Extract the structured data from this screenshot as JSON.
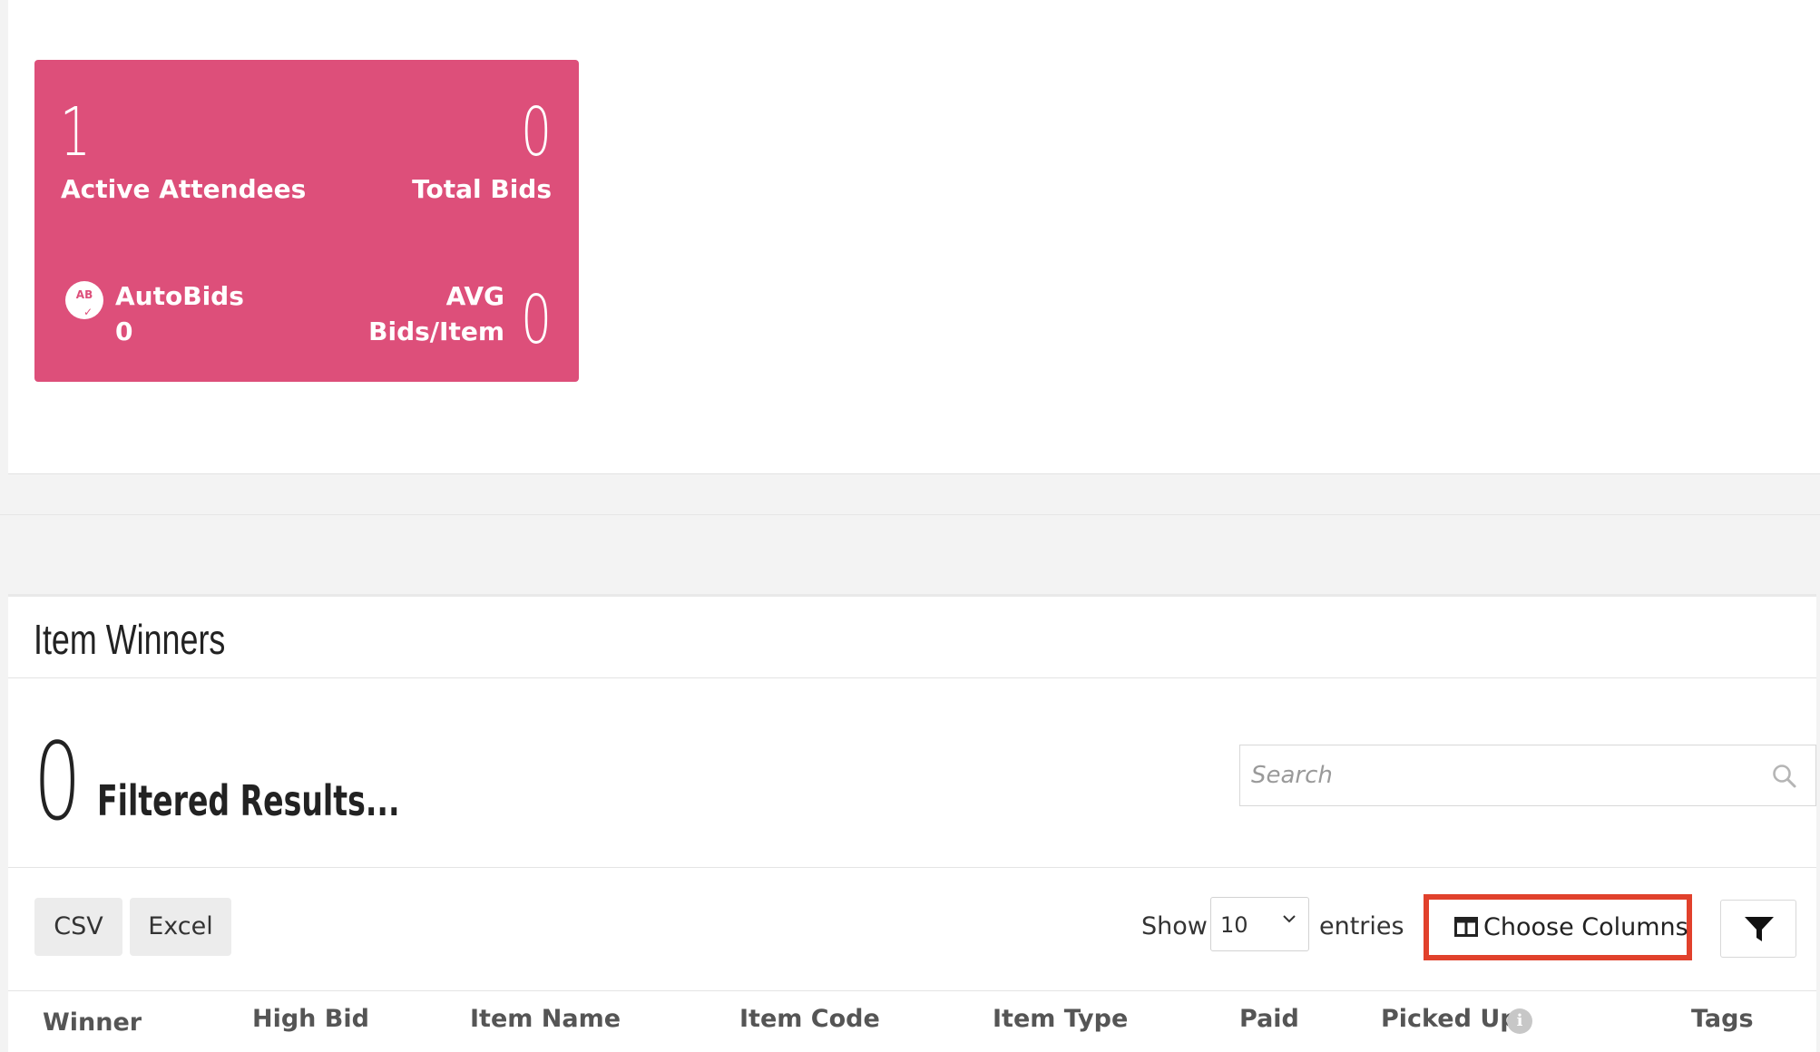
{
  "stats": {
    "active_attendees_count": "1",
    "active_attendees_label": "Active Attendees",
    "total_bids_count": "0",
    "total_bids_label": "Total Bids",
    "autobids_icon_text": "AB",
    "autobids_label": "AutoBids",
    "autobids_count": "0",
    "avg_label_line1": "AVG",
    "avg_label_line2": "Bids/Item",
    "avg_count": "0"
  },
  "item_winners": {
    "title": "Item Winners",
    "result_count": "0",
    "result_label": "Filtered Results...",
    "search_placeholder": "Search",
    "csv_label": "CSV",
    "excel_label": "Excel",
    "show_label": "Show",
    "entries_value": "10",
    "entries_label": "entries",
    "choose_columns_label": "Choose Columns",
    "columns": [
      "Winner",
      "High Bid",
      "Item Name",
      "Item Code",
      "Item Type",
      "Paid",
      "Picked Up",
      "Tags"
    ],
    "info_icon_text": "i"
  },
  "colors": {
    "card_bg": "#dd4f7a",
    "highlight_border": "#e1412c"
  }
}
